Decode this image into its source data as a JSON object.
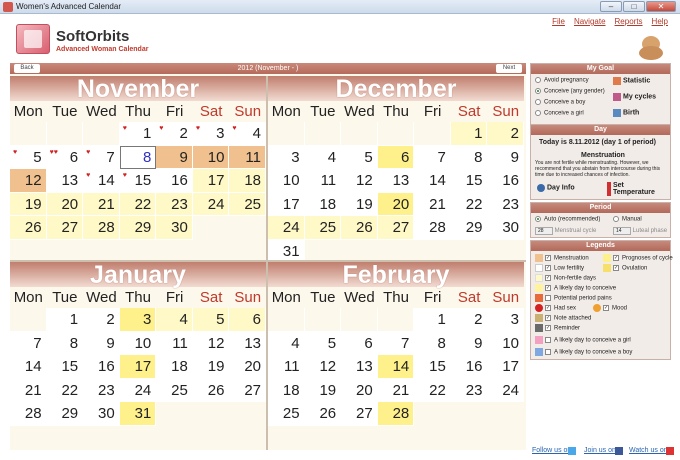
{
  "window": {
    "title": "Women's Advanced Calendar"
  },
  "app": {
    "brand": "SoftOrbits",
    "subtitle": "Advanced Woman Calendar"
  },
  "menu": [
    "File",
    "Navigate",
    "Reports",
    "Help"
  ],
  "nav": {
    "back_label": "Back",
    "next_label": "Next",
    "title": "2012 (November - )"
  },
  "weekdays": [
    "Mon",
    "Tue",
    "Wed",
    "Thu",
    "Fri",
    "Sat",
    "Sun"
  ],
  "months": [
    {
      "name": "November",
      "offset": 3,
      "days": 30,
      "today": 8,
      "men": [
        9,
        10,
        11,
        12
      ],
      "white": [
        1,
        2,
        3,
        4,
        5,
        6,
        7,
        13,
        14,
        15,
        16
      ],
      "prog": [],
      "fert": [
        18,
        22,
        25
      ]
    },
    {
      "name": "December",
      "offset": 5,
      "days": 31,
      "men": [],
      "white": [
        3,
        4,
        5,
        7,
        8,
        9,
        10,
        11,
        12,
        13,
        14,
        15,
        16,
        17,
        18,
        19,
        21,
        22,
        23,
        28,
        29,
        30,
        31
      ],
      "prog": [
        6,
        20
      ],
      "fert": [
        1,
        2,
        24,
        25,
        26,
        27
      ]
    },
    {
      "name": "January",
      "offset": 1,
      "days": 31,
      "men": [],
      "white": [
        1,
        2,
        7,
        8,
        9,
        10,
        11,
        12,
        13,
        14,
        15,
        16,
        18,
        19,
        20,
        21,
        22,
        23,
        24,
        25,
        26,
        27,
        28,
        29,
        30
      ],
      "prog": [
        3,
        17,
        31
      ],
      "fert": [
        4,
        5,
        6
      ]
    },
    {
      "name": "February",
      "offset": 4,
      "days": 28,
      "men": [],
      "white": [
        1,
        2,
        3,
        4,
        5,
        6,
        7,
        8,
        9,
        10,
        11,
        12,
        13,
        15,
        16,
        17,
        18,
        19,
        20,
        21,
        22,
        23,
        24,
        25,
        26,
        27
      ],
      "prog": [
        14,
        28
      ],
      "fert": []
    }
  ],
  "marks": {
    "m0_2": "♥",
    "m0_3": "♥",
    "m0_4": "♥",
    "m0_5": "♥",
    "m0_6": "♥♥",
    "m0_7": "♥",
    "m0_14": "♥",
    "m0_15": "♥",
    "m0_1": "♥"
  },
  "goal": {
    "title": "My Goal",
    "options": [
      "Avoid pregnancy",
      "Conceive (any gender)",
      "Conceive a boy",
      "Conceive a girl"
    ],
    "selected": 1,
    "buttons": [
      "Statistic",
      "My cycles",
      "Birth"
    ]
  },
  "day": {
    "title": "Day",
    "today_text": "Today is 8.11.2012 (day 1 of period)",
    "subtitle": "Menstruation",
    "note": "You are not fertile while menstruating. However, we recommend that you abstain from intercourse during this time due to increased chances of infection.",
    "day_info": "Day Info",
    "set_temp": "Set Temperature"
  },
  "period": {
    "title": "Period",
    "auto_label": "Auto (recommended)",
    "manual_label": "Manual",
    "cycle_value": "28",
    "cycle_label": "Menstrual cycle",
    "luteal_value": "14",
    "luteal_label": "Luteal phase"
  },
  "legends": {
    "title": "Legends",
    "items": [
      {
        "label": "Menstruation",
        "color": "#f0c08e"
      },
      {
        "label": "Prognoses of cycle",
        "color": "#fef08b"
      },
      {
        "label": "Low fertility",
        "color": "#ffffff"
      },
      {
        "label": "Ovulation",
        "color": "#f7e06a"
      },
      {
        "label": "Non-fertile days",
        "color": "#fff9c8"
      },
      {
        "label": "A likely day to conceive",
        "color": "#fff3a0"
      },
      {
        "label": "Potential period pains",
        "color": "#e86a3a"
      },
      {
        "label": "Had sex",
        "color": "#d32020"
      },
      {
        "label": "Mood",
        "color": "#f0a030"
      },
      {
        "label": "Note attached",
        "color": "#c9b072"
      },
      {
        "label": "Reminder",
        "color": "#6a6a6a"
      },
      {
        "label": "A likely day to conceive a girl",
        "color": "#f4a0c0"
      },
      {
        "label": "A likely day to conceive a boy",
        "color": "#7fa8e0"
      }
    ]
  },
  "footer": {
    "twitter": "Follow us on",
    "join": "Join us on",
    "youtube": "Watch us on"
  }
}
